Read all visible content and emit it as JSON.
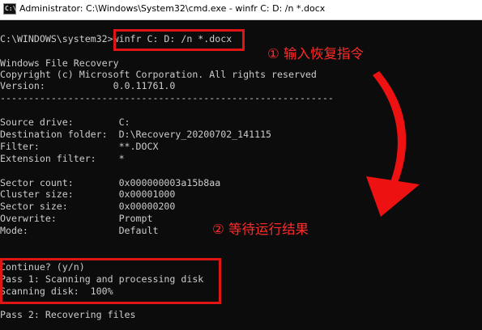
{
  "window": {
    "title": "Administrator: C:\\Windows\\System32\\cmd.exe - winfr  C: D: /n *.docx",
    "icon_text": "C:\\"
  },
  "console": {
    "prompt": "C:\\WINDOWS\\system32>",
    "command": "winfr C: D: /n *.docx",
    "header": [
      "Windows File Recovery",
      "Copyright (c) Microsoft Corporation. All rights reserved",
      "Version:            0.0.11761.0",
      "-----------------------------------------------------------"
    ],
    "settings": [
      "Source drive:        C:",
      "Destination folder:  D:\\Recovery_20200702_141115",
      "Filter:              **.DOCX",
      "Extension filter:    *"
    ],
    "disk_info": [
      "Sector count:        0x000000003a15b8aa",
      "Cluster size:        0x00001000",
      "Sector size:         0x00000200",
      "Overwrite:           Prompt",
      "Mode:                Default"
    ],
    "progress": [
      "Continue? (y/n)",
      "Pass 1: Scanning and processing disk",
      "Scanning disk:  100%"
    ],
    "pass2": "Pass 2: Recovering files"
  },
  "annotations": {
    "step1": "① 输入恢复指令",
    "step2": "② 等待运行结果",
    "color": "#e01515"
  }
}
